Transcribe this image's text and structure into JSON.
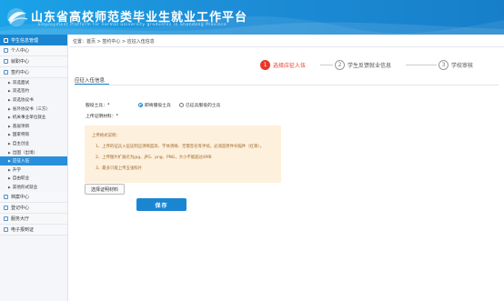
{
  "header": {
    "title": "山东省高校师范类毕业生就业工作平台",
    "subtitle": "Employment Platform for normal university graduates in Shandong Province"
  },
  "sidebar": {
    "active_section": "学生信息管理",
    "groups_top": [
      {
        "label": "个人中心",
        "icon": "person-icon"
      },
      {
        "label": "就职中心",
        "icon": "briefcase-icon"
      },
      {
        "label": "签约中心",
        "icon": "contract-icon"
      }
    ],
    "items": [
      {
        "label": "双选面试",
        "active": false
      },
      {
        "label": "双选签约",
        "active": false
      },
      {
        "label": "双选协议书",
        "active": false
      },
      {
        "label": "省外协议书（三方）",
        "active": false
      },
      {
        "label": "机关事业单位就业",
        "active": false
      },
      {
        "label": "基层项目",
        "active": false
      },
      {
        "label": "国家特岗",
        "active": false
      },
      {
        "label": "自主创业",
        "active": false
      },
      {
        "label": "出国（出境）",
        "active": false
      },
      {
        "label": "应征入伍",
        "active": true
      },
      {
        "label": "升学",
        "active": false
      },
      {
        "label": "自由职业",
        "active": false
      },
      {
        "label": "其他形式就业",
        "active": false
      }
    ],
    "groups_bottom": [
      {
        "label": "档案中心",
        "icon": "archive-icon"
      },
      {
        "label": "登记中心",
        "icon": "register-icon"
      },
      {
        "label": "服务大厅",
        "icon": "service-icon"
      },
      {
        "label": "电子报到证",
        "icon": "certificate-icon"
      }
    ]
  },
  "breadcrumb": "位置：首页 > 签约中心 > 应征入伍信息",
  "steps": [
    {
      "num": "1",
      "label": "选择应征入伍",
      "active": true
    },
    {
      "num": "2",
      "label": "学生反馈就业信息",
      "active": false
    },
    {
      "num": "3",
      "label": "学校审核",
      "active": false
    }
  ],
  "tab": "应征入伍信息",
  "form": {
    "soldier_type_label": "服役士兵：*",
    "radio_options": [
      {
        "label": "即将服役士兵",
        "checked": true
      },
      {
        "label": "已征兵服役的士兵",
        "checked": false
      }
    ],
    "upload_label": "上传证明材料：*",
    "notice_lines": [
      "上传格式说明：",
      "1、上传的征兵入伍证明应清晰度高、字体清晰、无需签名等手续，必须是原件扫描件（红章）。",
      "2、上传图片扩展名为jpg、JPG、png、PNG，大小不能超过4MB",
      "3、最多只能上传五张照片"
    ],
    "upload_button": "选择证明材料",
    "save_button": "保存"
  },
  "colors": {
    "header_blue": "#1d8fd8",
    "active_blue": "#1a86d2",
    "step_red": "#e8392c",
    "notice_bg": "#fdf0dd"
  }
}
